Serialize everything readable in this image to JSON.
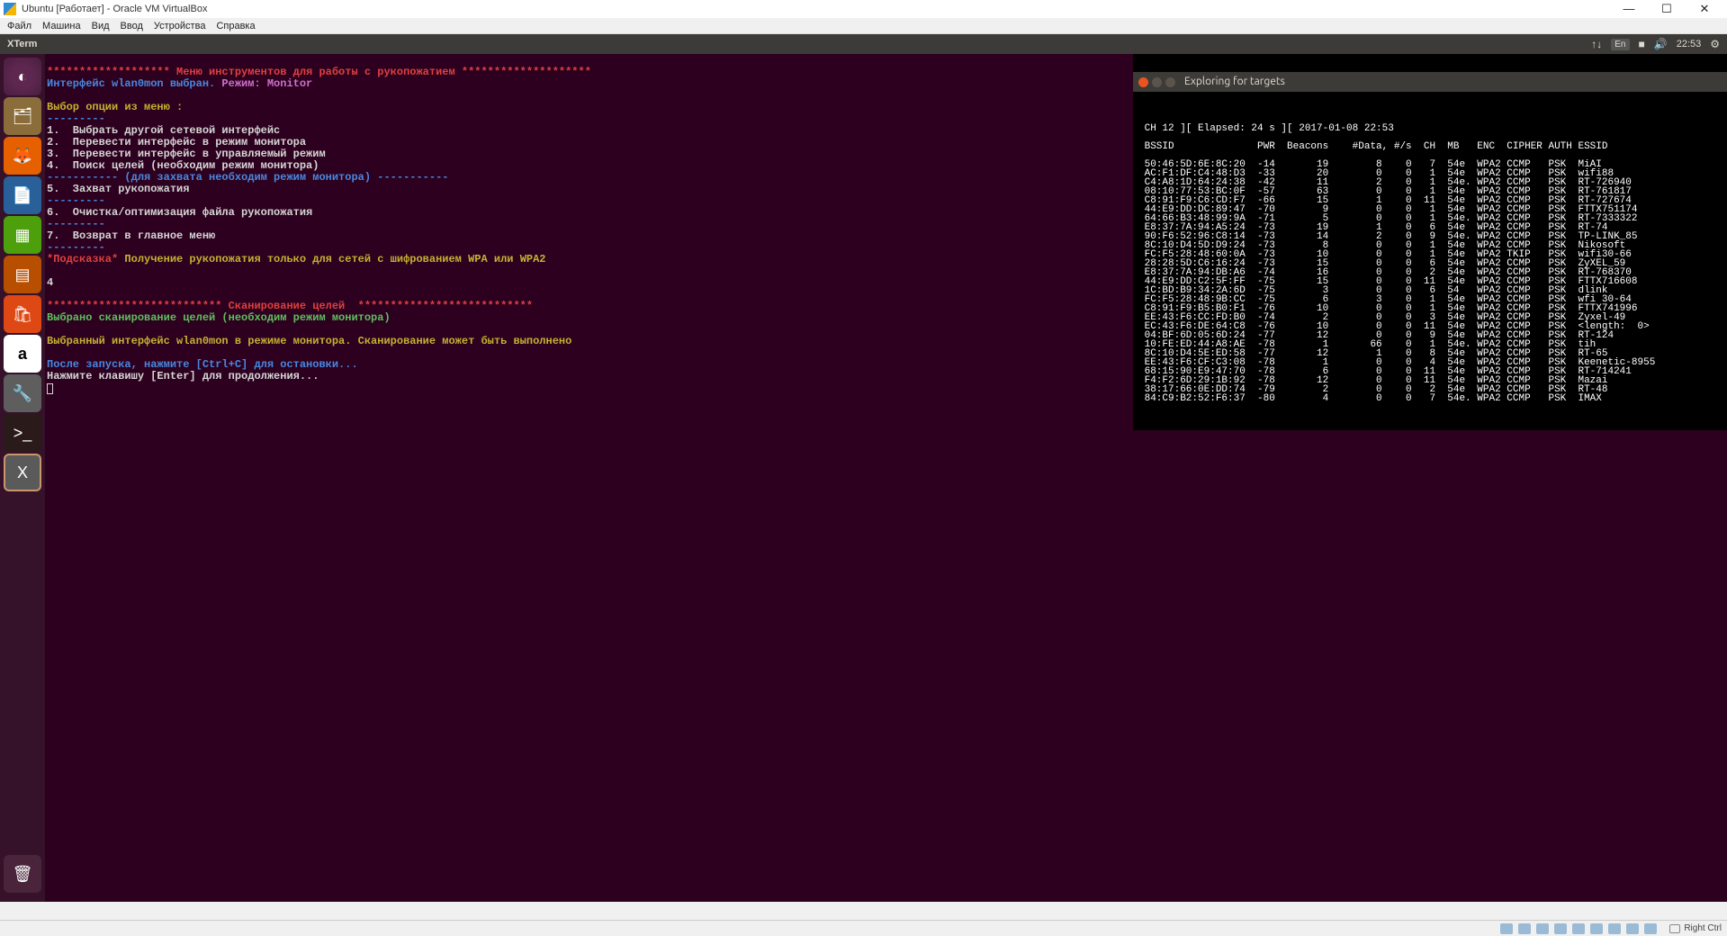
{
  "win": {
    "title": "Ubuntu [Работает] - Oracle VM VirtualBox",
    "menu": [
      "Файл",
      "Машина",
      "Вид",
      "Ввод",
      "Устройства",
      "Справка"
    ],
    "status_right": "Right Ctrl"
  },
  "ubuntu": {
    "top_title": "XTerm",
    "clock": "22:53",
    "kb_layout": "En",
    "net_icon": "↑↓",
    "battery_icon": "■",
    "volume_icon": "🔊",
    "gear_icon": "⚙"
  },
  "launcher": {
    "dash": "◐",
    "files": "🗂",
    "firefox": "🦊",
    "writer": "📄",
    "calc": "▦",
    "impress": "▤",
    "usc": "🛍",
    "amazon": "a",
    "settings": "🔧",
    "term": ">_",
    "xterm": "X",
    "trash": "🗑"
  },
  "xterm": {
    "l1": "******************* Меню инструментов для работы с рукопожатием ********************",
    "l2a": "Интерфейс wlan0mon выбран.",
    "l2b": " Режим: Monitor",
    "l3": "Выбор опции из меню :",
    "sep": "---------",
    "m1": "1.  Выбрать другой сетевой интерфейс",
    "m2": "2.  Перевести интерфейс в режим монитора",
    "m3": "3.  Перевести интерфейс в управляемый режим",
    "m4": "4.  Поиск целей (необходим режим монитора)",
    "capsep": "----------- (для захвата необходим режим монитора) -----------",
    "m5": "5.  Захват рукопожатия",
    "m6": "6.  Очистка/оптимизация файла рукопожатия",
    "m7": "7.  Возврат в главное меню",
    "hint_star": "*Подсказка*",
    "hint_rest": " Получение рукопожатия только для сетей с шифрованием WPA или WPA2",
    "input": "4",
    "scan_hdr": "*************************** Сканирование целей  ***************************",
    "scan1": "Выбрано сканирование целей (необходим режим монитора)",
    "scan2": "Выбранный интерфейс wlan0mon в режиме монитора. Сканирование может быть выполнено",
    "after1": "После запуска, нажмите [Ctrl+C] для остановки...",
    "after2": "Нажмите клавишу [Enter] для продолжения..."
  },
  "explore": {
    "title": "Exploring for targets",
    "status": " CH 12 ][ Elapsed: 24 s ][ 2017-01-08 22:53",
    "hdr": " BSSID              PWR  Beacons    #Data, #/s  CH  MB   ENC  CIPHER AUTH ESSID",
    "rows": [
      " 50:46:5D:6E:8C:20  -14       19        8    0   7  54e  WPA2 CCMP   PSK  MiAI",
      " AC:F1:DF:C4:48:D3  -33       20        0    0   1  54e  WPA2 CCMP   PSK  wifi88",
      " C4:A8:1D:64:24:38  -42       11        2    0   1  54e. WPA2 CCMP   PSK  RT-726940",
      " 08:10:77:53:BC:0F  -57       63        0    0   1  54e  WPA2 CCMP   PSK  RT-761817",
      " C8:91:F9:C6:CD:F7  -66       15        1    0  11  54e  WPA2 CCMP   PSK  RT-727674",
      " 44:E9:DD:DC:89:47  -70        9        0    0   1  54e  WPA2 CCMP   PSK  FTTX751174",
      " 64:66:B3:48:99:9A  -71        5        0    0   1  54e. WPA2 CCMP   PSK  RT-7333322",
      " E8:37:7A:94:A5:24  -73       19        1    0   6  54e  WPA2 CCMP   PSK  RT-74",
      " 90:F6:52:96:C8:14  -73       14        2    0   9  54e. WPA2 CCMP   PSK  TP-LINK_85",
      " 8C:10:D4:5D:D9:24  -73        8        0    0   1  54e  WPA2 CCMP   PSK  Nikosoft",
      " FC:F5:28:48:60:0A  -73       10        0    0   1  54e  WPA2 TKIP   PSK  wifi30-66",
      " 28:28:5D:C6:16:24  -73       15        0    0   6  54e  WPA2 CCMP   PSK  ZyXEL_59",
      " E8:37:7A:94:DB:A6  -74       16        0    0   2  54e  WPA2 CCMP   PSK  RT-768370",
      " 44:E9:DD:C2:5F:FF  -75       15        0    0  11  54e  WPA2 CCMP   PSK  FTTX716608",
      " 1C:BD:B9:34:2A:6D  -75        3        0    0   6  54   WPA2 CCMP   PSK  dlink",
      " FC:F5:28:48:9B:CC  -75        6        3    0   1  54e  WPA2 CCMP   PSK  wfi 30-64",
      " C8:91:F9:B5:B0:F1  -76       10        0    0   1  54e  WPA2 CCMP   PSK  FTTX741996",
      " EE:43:F6:CC:FD:B0  -74        2        0    0   3  54e  WPA2 CCMP   PSK  Zyxel-49",
      " EC:43:F6:DE:64:C8  -76       10        0    0  11  54e  WPA2 CCMP   PSK  <length:  0>",
      " 04:BF:6D:05:6D:24  -77       12        0    0   9  54e  WPA2 CCMP   PSK  RT-124",
      " 10:FE:ED:44:A8:AE  -78        1       66    0   1  54e. WPA2 CCMP   PSK  tih",
      " 8C:10:D4:5E:ED:58  -77       12        1    0   8  54e  WPA2 CCMP   PSK  RT-65",
      " EE:43:F6:CF:C3:08  -78        1        0    0   4  54e  WPA2 CCMP   PSK  Keenetic-8955",
      " 68:15:90:E9:47:70  -78        6        0    0  11  54e  WPA2 CCMP   PSK  RT-714241",
      " F4:F2:6D:29:1B:92  -78       12        0    0  11  54e  WPA2 CCMP   PSK  Mazai",
      " 38:17:66:0E:DD:74  -79        2        0    0   2  54e  WPA2 CCMP   PSK  RT-48",
      " 84:C9:B2:52:F6:37  -80        4        0    0   7  54e. WPA2 CCMP   PSK  IMAX"
    ]
  }
}
